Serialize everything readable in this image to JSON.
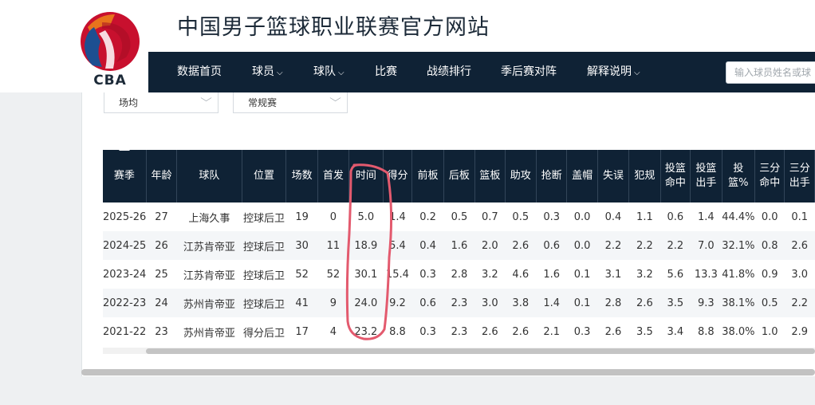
{
  "site": {
    "title": "中国男子篮球职业联赛官方网站",
    "logo_text": "CBA",
    "colors": {
      "nav_bg": "#0f2235",
      "logo_red": "#c8102e",
      "logo_orange": "#e8731c",
      "logo_blue": "#1d4f91",
      "annotation": "#e35a6e"
    }
  },
  "nav": {
    "items": [
      {
        "label": "数据首页",
        "has_dropdown": false
      },
      {
        "label": "球员",
        "has_dropdown": true
      },
      {
        "label": "球队",
        "has_dropdown": true
      },
      {
        "label": "比赛",
        "has_dropdown": false
      },
      {
        "label": "战绩排行",
        "has_dropdown": false
      },
      {
        "label": "季后赛对阵",
        "has_dropdown": false
      },
      {
        "label": "解释说明",
        "has_dropdown": true
      }
    ],
    "caret": "⌵",
    "search_placeholder": "输入球员姓名或球"
  },
  "filters": {
    "stat_mode": "场均",
    "season_type": "常规赛",
    "arrow": "⌵"
  },
  "table": {
    "headers": [
      "赛季",
      "年龄",
      "球队",
      "位置",
      "场数",
      "首发",
      "时间",
      "得分",
      "前板",
      "后板",
      "篮板",
      "助攻",
      "抢断",
      "盖帽",
      "失误",
      "犯规",
      "投篮命中",
      "投篮出手",
      "投篮%",
      "三分命中",
      "三分出手"
    ],
    "rows": [
      [
        "2025-26",
        "27",
        "上海久事",
        "控球后卫",
        "19",
        "0",
        "5.0",
        "1.4",
        "0.2",
        "0.5",
        "0.7",
        "0.5",
        "0.3",
        "0.0",
        "0.4",
        "1.1",
        "0.6",
        "1.4",
        "44.4%",
        "0.0",
        "0.1"
      ],
      [
        "2024-25",
        "26",
        "江苏肯帝亚",
        "控球后卫",
        "30",
        "11",
        "18.9",
        "5.4",
        "0.4",
        "1.6",
        "2.0",
        "2.6",
        "0.6",
        "0.0",
        "2.2",
        "2.2",
        "2.2",
        "7.0",
        "32.1%",
        "0.8",
        "2.6"
      ],
      [
        "2023-24",
        "25",
        "江苏肯帝亚",
        "控球后卫",
        "52",
        "52",
        "30.1",
        "15.4",
        "0.3",
        "2.8",
        "3.2",
        "4.6",
        "1.6",
        "0.1",
        "3.1",
        "3.2",
        "5.6",
        "13.3",
        "41.8%",
        "0.9",
        "3.0"
      ],
      [
        "2022-23",
        "24",
        "苏州肯帝亚",
        "控球后卫",
        "41",
        "9",
        "24.0",
        "9.2",
        "0.6",
        "2.3",
        "3.0",
        "3.8",
        "1.4",
        "0.1",
        "2.8",
        "2.6",
        "3.5",
        "9.3",
        "38.1%",
        "0.5",
        "2.2"
      ],
      [
        "2021-22",
        "23",
        "苏州肯帝亚",
        "得分后卫",
        "17",
        "4",
        "23.2",
        "8.8",
        "0.3",
        "2.3",
        "2.6",
        "2.6",
        "2.1",
        "0.3",
        "2.6",
        "3.5",
        "3.4",
        "8.8",
        "38.0%",
        "1.0",
        "2.9"
      ]
    ]
  }
}
